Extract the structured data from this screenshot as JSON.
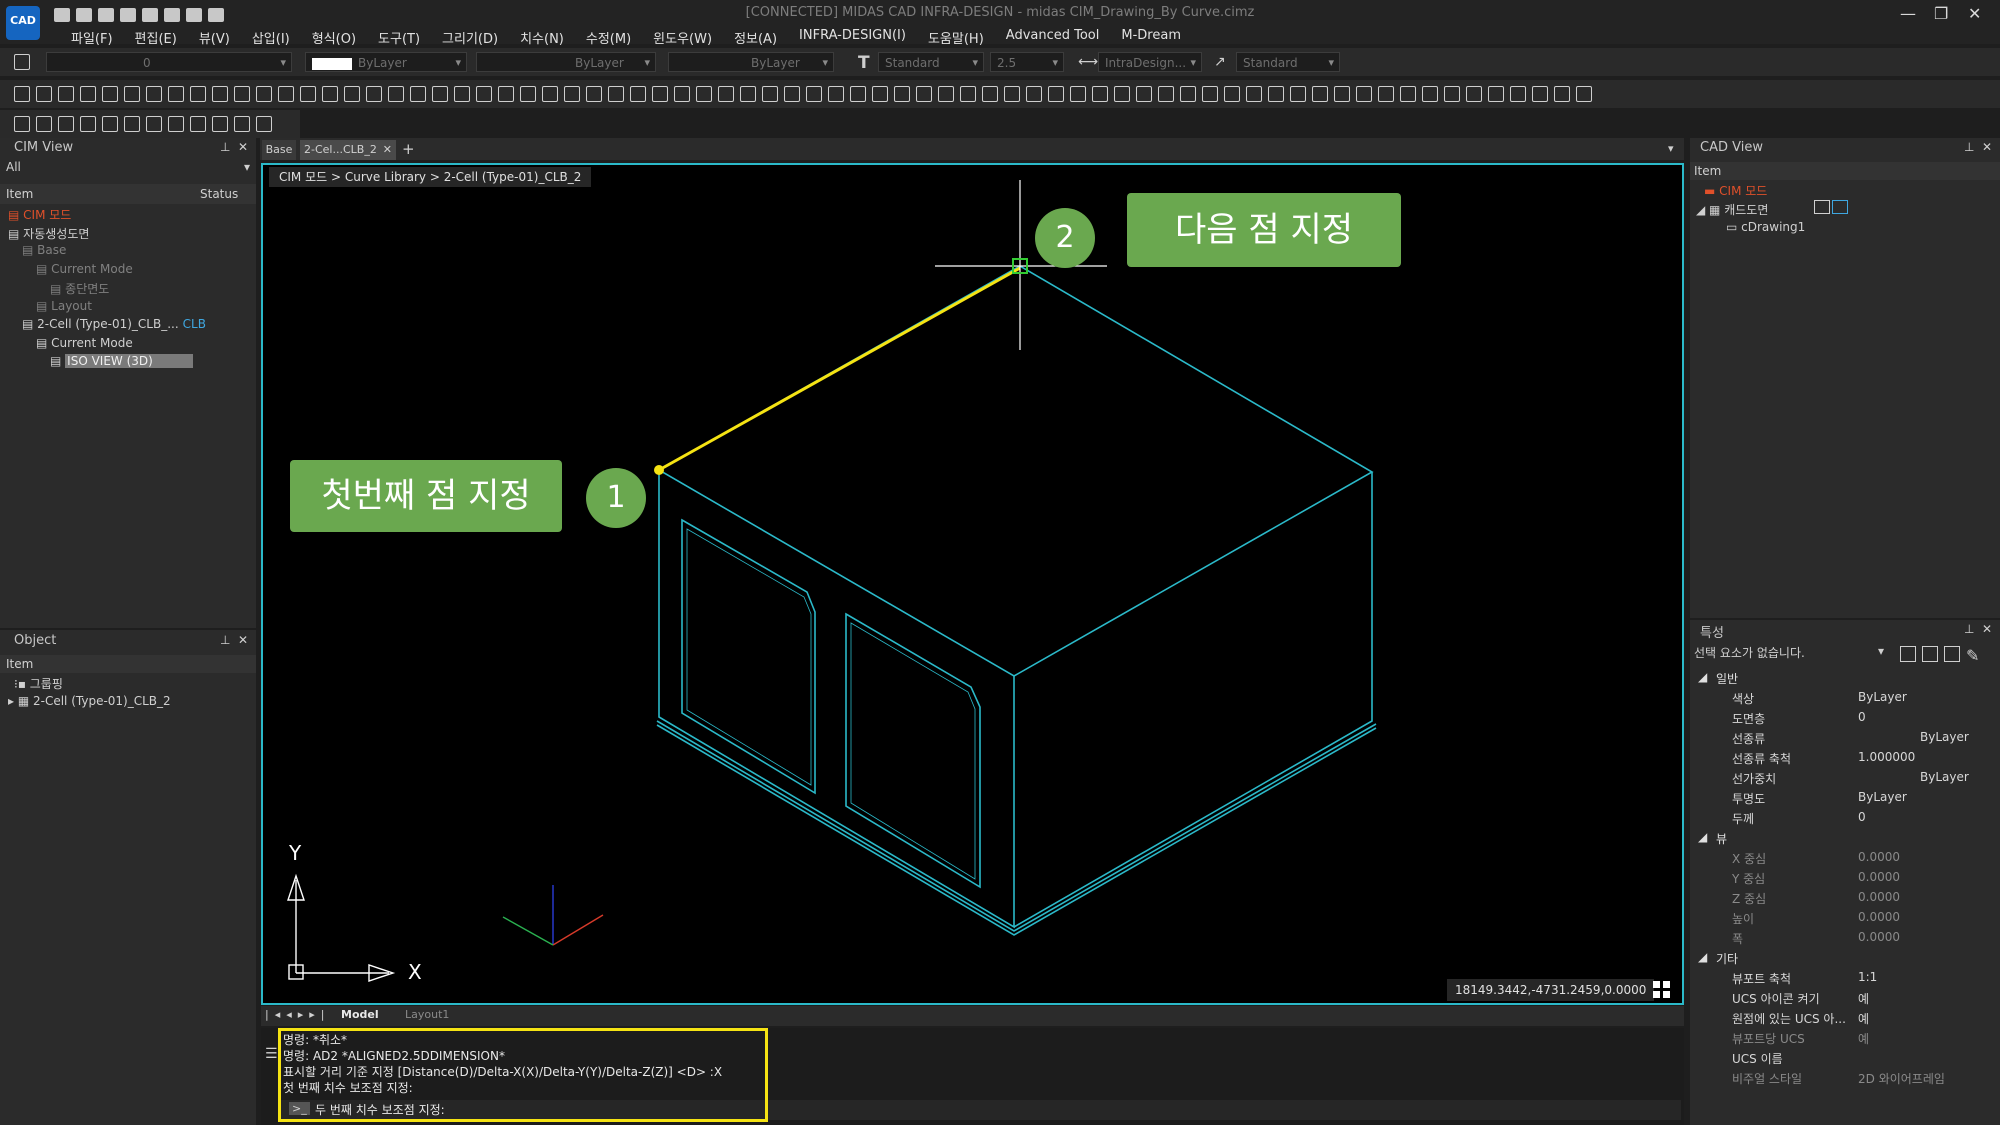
{
  "window": {
    "title": "[CONNECTED] MIDAS CAD INFRA-DESIGN - midas CIM_Drawing_By Curve.cimz",
    "logo": "CAD",
    "min": "—",
    "max": "❐",
    "close": "✕"
  },
  "menu": [
    "파일(F)",
    "편집(E)",
    "뷰(V)",
    "삽입(I)",
    "형식(O)",
    "도구(T)",
    "그리기(D)",
    "치수(N)",
    "수정(M)",
    "윈도우(W)",
    "정보(A)",
    "INFRA-DESIGN(I)",
    "도움말(H)",
    "Advanced Tool",
    "M-Dream"
  ],
  "toolbar": {
    "layer_value": "0",
    "color_value": "ByLayer",
    "linetype_value": "ByLayer",
    "lineweight_value": "ByLayer",
    "textstyle_value": "Standard",
    "textheight_value": "2.5",
    "dimstyle_value": "IntraDesign...",
    "multileader_value": "Standard"
  },
  "cim_view": {
    "title": "CIM View",
    "filter": "All",
    "col_item": "Item",
    "col_status": "Status",
    "tree": [
      {
        "label": "CIM 모드",
        "color": "#e0502a",
        "level": 0
      },
      {
        "label": "자동생성도면",
        "color": "#d0d0d0",
        "level": 0
      },
      {
        "label": "Base",
        "color": "#808080",
        "level": 1
      },
      {
        "label": "Current Mode",
        "color": "#808080",
        "level": 2
      },
      {
        "label": "종단면도",
        "color": "#808080",
        "level": 3
      },
      {
        "label": "Layout",
        "color": "#808080",
        "level": 2
      },
      {
        "label": "2-Cell (Type-01)_CLB_...",
        "badge": "CLB",
        "color": "#d0d0d0",
        "level": 1
      },
      {
        "label": "Current Mode",
        "color": "#d0d0d0",
        "level": 2
      },
      {
        "label": "ISO VIEW (3D)",
        "color": "#d0d0d0",
        "level": 3,
        "selected": true
      }
    ]
  },
  "object_panel": {
    "title": "Object",
    "col_item": "Item",
    "tree": [
      {
        "label": "그룹핑"
      },
      {
        "label": "2-Cell (Type-01)_CLB_2"
      }
    ]
  },
  "doc_tabs": {
    "tab_base": "Base",
    "tab_active": "2-Cel...CLB_2",
    "close": "✕",
    "add": "+"
  },
  "breadcrumb": "CIM 모드 > Curve Library > 2-Cell (Type-01)_CLB_2",
  "annotations": {
    "first_point": "첫번째 점 지정",
    "next_point": "다음 점 지정",
    "marker1": "1",
    "marker2": "2"
  },
  "ucs": {
    "y": "Y",
    "x": "X"
  },
  "coords": "18149.3442,-4731.2459,0.0000",
  "layout_tabs": {
    "model": "Model",
    "layout1": "Layout1"
  },
  "command_lines": [
    "명령:  *취소*",
    "명령:  AD2 *ALIGNED2.5DDIMENSION*",
    "표시할 거리 기준 지정 [Distance(D)/Delta-X(X)/Delta-Y(Y)/Delta-Z(Z)] <D> :X",
    "첫 번째 치수 보조점 지정:"
  ],
  "command_prompt": "두 번째 치수 보조점 지정:",
  "cad_view": {
    "title": "CAD View",
    "col_item": "Item",
    "tree": [
      {
        "label": "CIM 모드",
        "color": "#e0502a"
      },
      {
        "label": "캐드도면",
        "color": "#d0d0d0"
      },
      {
        "label": "cDrawing1",
        "color": "#d0d0d0"
      }
    ]
  },
  "properties": {
    "title": "특성",
    "selection": "선택 요소가 없습니다.",
    "groups": [
      {
        "name": "일반",
        "rows": [
          {
            "k": "색상",
            "v": "ByLayer"
          },
          {
            "k": "도면층",
            "v": "0"
          },
          {
            "k": "선종류",
            "v": "ByLayer"
          },
          {
            "k": "선종류 축척",
            "v": "1.000000"
          },
          {
            "k": "선가중치",
            "v": "ByLayer"
          },
          {
            "k": "투명도",
            "v": "ByLayer"
          },
          {
            "k": "두께",
            "v": "0"
          }
        ]
      },
      {
        "name": "뷰",
        "rows": [
          {
            "k": "X 중심",
            "v": "0.0000"
          },
          {
            "k": "Y 중심",
            "v": "0.0000"
          },
          {
            "k": "Z 중심",
            "v": "0.0000"
          },
          {
            "k": "높이",
            "v": "0.0000"
          },
          {
            "k": "폭",
            "v": "0.0000"
          }
        ]
      },
      {
        "name": "기타",
        "rows": [
          {
            "k": "뷰포트 축척",
            "v": "1:1"
          },
          {
            "k": "UCS 아이콘 켜기",
            "v": "예"
          },
          {
            "k": "원점에 있는 UCS 아...",
            "v": "예"
          },
          {
            "k": "뷰포트당 UCS",
            "v": "예"
          },
          {
            "k": "UCS 이름",
            "v": ""
          },
          {
            "k": "비주얼 스타일",
            "v": "2D 와이어프레임"
          }
        ]
      }
    ]
  },
  "colors": {
    "accent": "#2bb9c9",
    "callout": "#6aa84f",
    "highlight": "#f5e313",
    "cim": "#e0502a"
  }
}
